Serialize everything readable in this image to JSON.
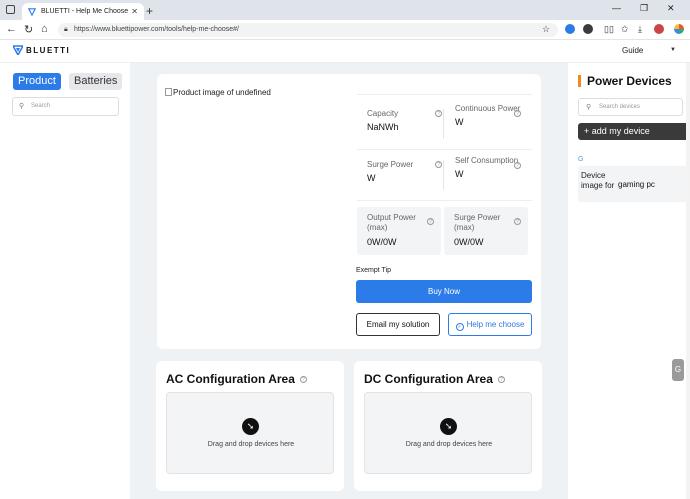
{
  "browser": {
    "tab_title": "BLUETTI - Help Me Choose",
    "new_tab_symbol": "+",
    "url": "https://www.bluettipower.com/tools/help-me-choose#/"
  },
  "header": {
    "logo_text": "BLUETTI",
    "guide_label": "Guide"
  },
  "left_panel": {
    "tabs": [
      {
        "label": "Product"
      },
      {
        "label": "Batteries"
      }
    ],
    "search_placeholder": "Search"
  },
  "product": {
    "image_alt": "Product image of undefined",
    "specs": {
      "capacity": {
        "label": "Capacity",
        "value": "NaNWh"
      },
      "continuous_power": {
        "label": "Continuous Power",
        "value": "W"
      },
      "surge_power": {
        "label": "Surge Power",
        "value": "W"
      },
      "self_consumption": {
        "label": "Self Consumption",
        "value": "W"
      },
      "output_power": {
        "label": "Output Power (max)",
        "value": "0W/0W"
      },
      "surge_power_max": {
        "label": "Surge Power (max)",
        "value": "0W/0W"
      }
    },
    "exempt_tip": "Exempt Tip",
    "buy_now": "Buy Now",
    "email_solution": "Email my solution",
    "help_me_choose": "Help me choose"
  },
  "config": {
    "ac_title": "AC Configuration Area",
    "dc_title": "DC Configuration Area",
    "drop_text": "Drag and drop devices here"
  },
  "right_panel": {
    "title": "Power Devices",
    "search_placeholder": "Search devices",
    "add_device": "+ add my device",
    "group_letter": "G",
    "devices": [
      {
        "image_alt": "Device image for",
        "name": "gaming pc"
      }
    ]
  },
  "floating_badge": "G",
  "colors": {
    "accent": "#2b7be8",
    "brand_orange": "#f08a1c",
    "dark_button": "#3a3a3a"
  }
}
